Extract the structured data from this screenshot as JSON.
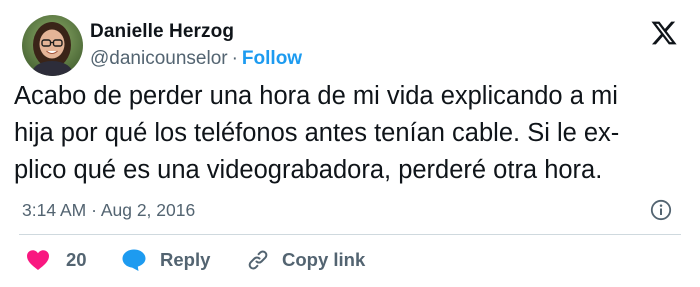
{
  "tweet": {
    "author": {
      "name": "Danielle Herzog",
      "handle": "@danicounselor",
      "separator": "·",
      "follow_label": "Follow"
    },
    "text_lines": [
      "Acabo de perder una hora de mi vida explicando a mi",
      "hija por qué los teléfonos antes tenían cable. Si le ex-",
      "plico qué es una videograbadora, perderé otra hora."
    ],
    "time": "3:14 AM",
    "date_separator": "·",
    "date": "Aug 2, 2016",
    "actions": {
      "like_count": "20",
      "reply_label": "Reply",
      "copy_link_label": "Copy link"
    }
  },
  "icons": {
    "platform_logo": "x-logo-icon",
    "info": "info-icon",
    "like": "heart-icon",
    "reply": "speech-bubble-icon",
    "copy_link": "link-icon"
  },
  "colors": {
    "accent": "#1d9bf0",
    "like": "#f91880",
    "text_primary": "#0f1419",
    "text_secondary": "#536471",
    "divider": "#cfd9de"
  }
}
